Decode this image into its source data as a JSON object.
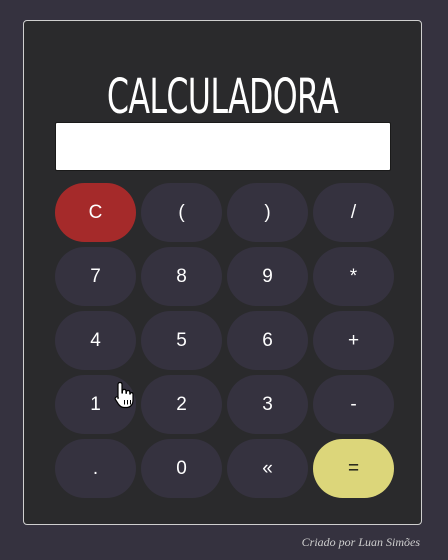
{
  "app": {
    "title": "CALCULADORA",
    "credit": "Criado por Luan Simões"
  },
  "display": {
    "value": ""
  },
  "keys": [
    {
      "label": "C",
      "name": "clear-button",
      "variant": "clear"
    },
    {
      "label": "(",
      "name": "open-paren-button",
      "variant": "normal"
    },
    {
      "label": ")",
      "name": "close-paren-button",
      "variant": "normal"
    },
    {
      "label": "/",
      "name": "divide-button",
      "variant": "normal"
    },
    {
      "label": "7",
      "name": "digit-7-button",
      "variant": "normal"
    },
    {
      "label": "8",
      "name": "digit-8-button",
      "variant": "normal"
    },
    {
      "label": "9",
      "name": "digit-9-button",
      "variant": "normal"
    },
    {
      "label": "*",
      "name": "multiply-button",
      "variant": "normal"
    },
    {
      "label": "4",
      "name": "digit-4-button",
      "variant": "normal"
    },
    {
      "label": "5",
      "name": "digit-5-button",
      "variant": "normal"
    },
    {
      "label": "6",
      "name": "digit-6-button",
      "variant": "normal"
    },
    {
      "label": "+",
      "name": "add-button",
      "variant": "normal"
    },
    {
      "label": "1",
      "name": "digit-1-button",
      "variant": "normal"
    },
    {
      "label": "2",
      "name": "digit-2-button",
      "variant": "normal"
    },
    {
      "label": "3",
      "name": "digit-3-button",
      "variant": "normal"
    },
    {
      "label": "-",
      "name": "subtract-button",
      "variant": "normal"
    },
    {
      "label": ".",
      "name": "decimal-button",
      "variant": "normal"
    },
    {
      "label": "0",
      "name": "digit-0-button",
      "variant": "normal"
    },
    {
      "label": "«",
      "name": "backspace-button",
      "variant": "normal"
    },
    {
      "label": "=",
      "name": "equals-button",
      "variant": "equals"
    }
  ],
  "colors": {
    "background": "#35323f",
    "card": "#2a2a2c",
    "key": "#35323f",
    "clear_key": "#a52a2a",
    "equals_key": "#dcd67a"
  },
  "icons": {
    "pointer": "hand-pointer-icon"
  }
}
